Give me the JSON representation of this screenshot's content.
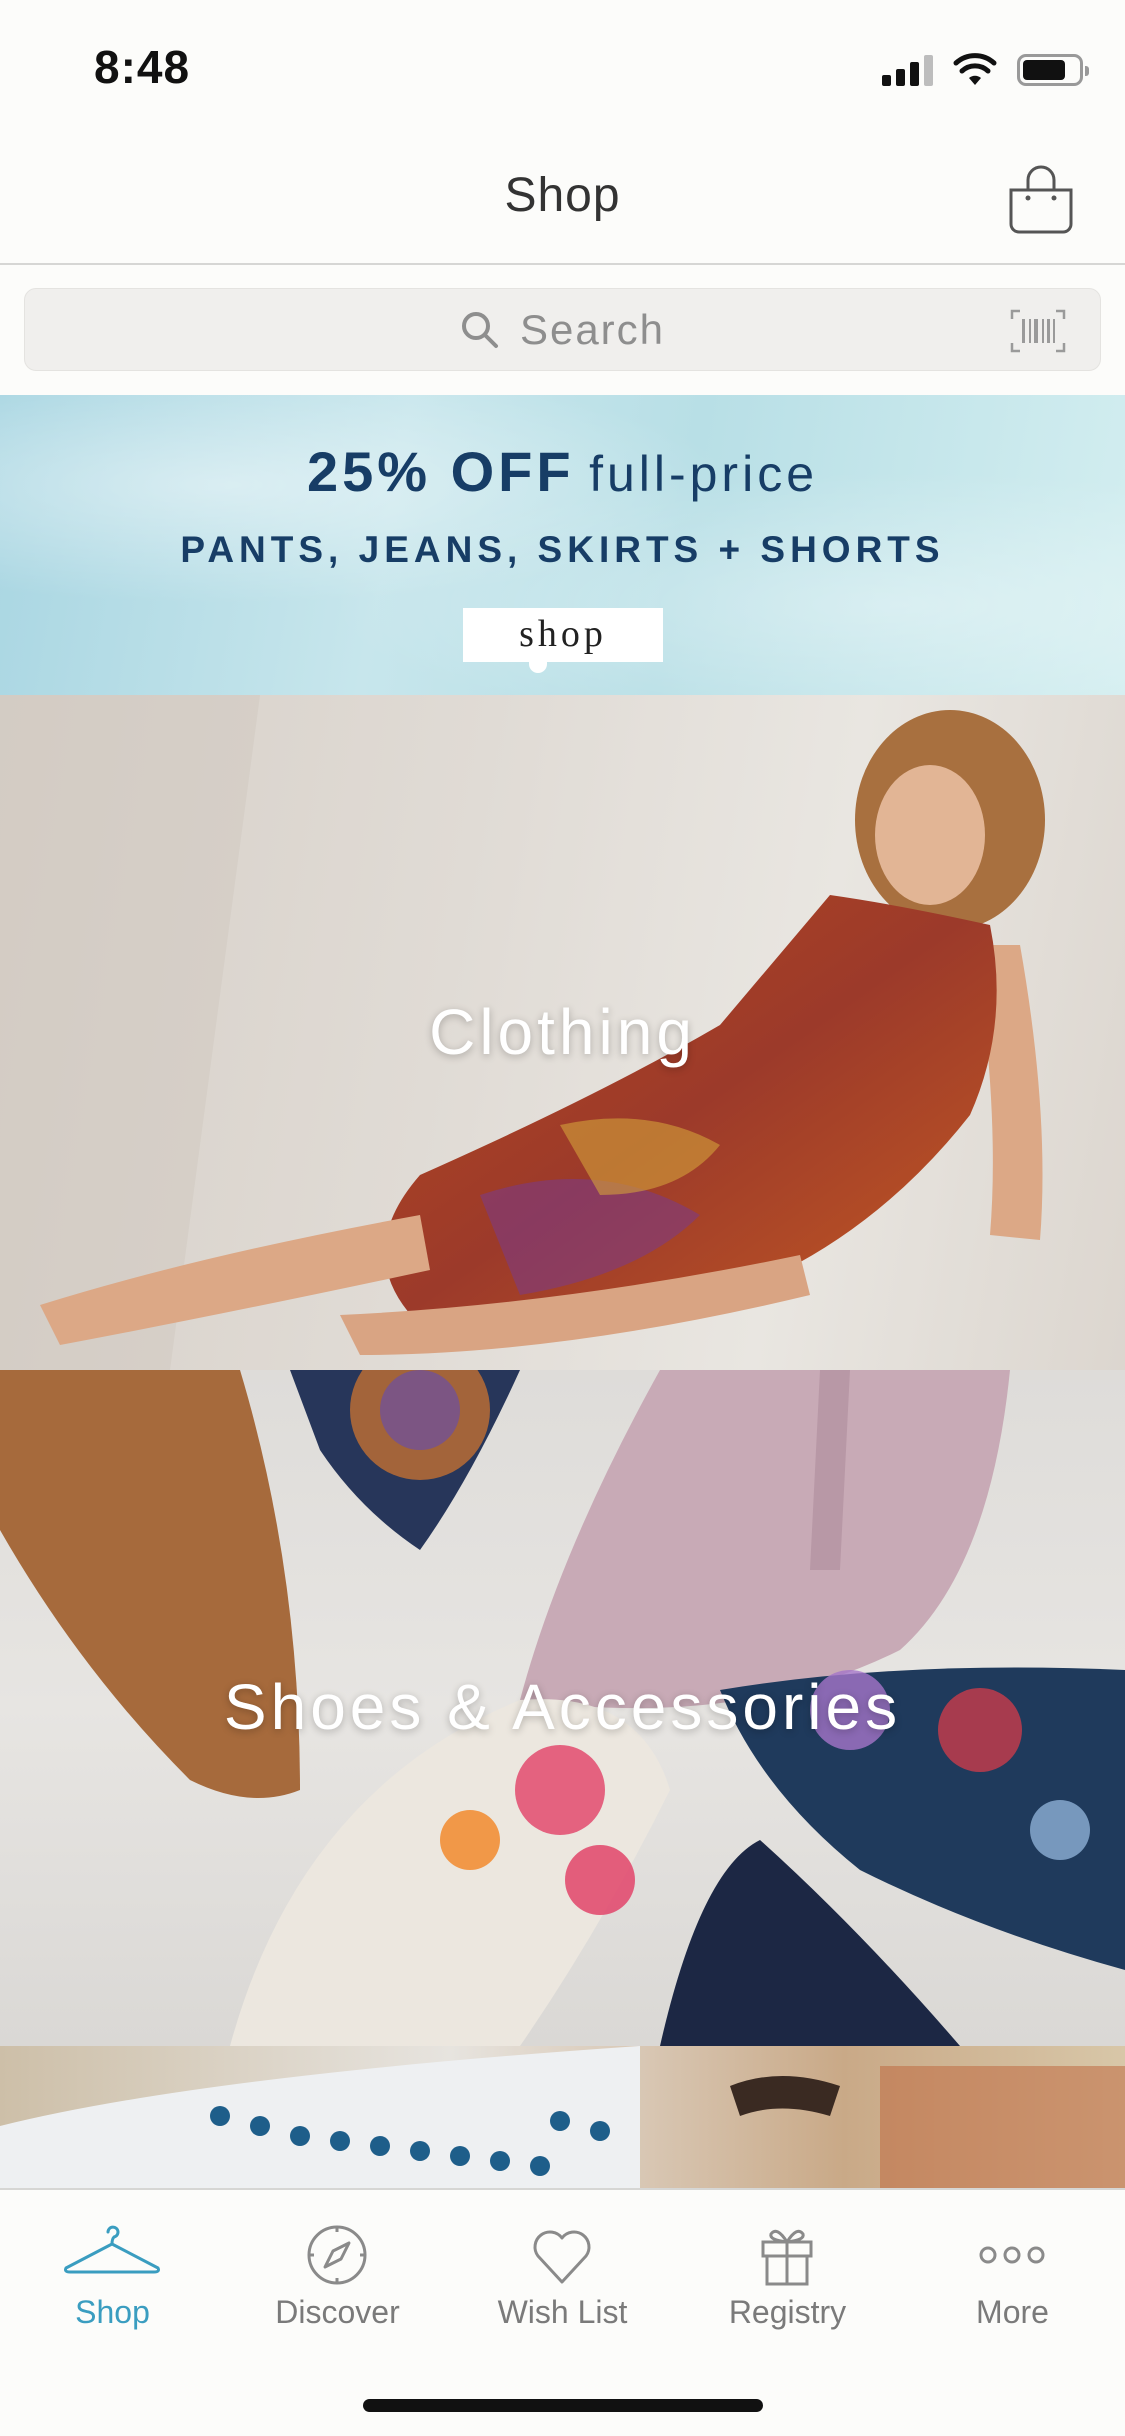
{
  "status_bar": {
    "time": "8:48"
  },
  "header": {
    "title": "Shop"
  },
  "search": {
    "placeholder": "Search"
  },
  "promo": {
    "percent": "25% OFF",
    "qualifier": "full-price",
    "categories": "PANTS, JEANS, SKIRTS + SHORTS",
    "cta": "shop"
  },
  "tiles": [
    {
      "label": "Clothing"
    },
    {
      "label": "Shoes & Accessories"
    },
    {
      "label": ""
    }
  ],
  "tabs": [
    {
      "label": "Shop",
      "icon": "hanger-icon",
      "active": true
    },
    {
      "label": "Discover",
      "icon": "compass-icon",
      "active": false
    },
    {
      "label": "Wish List",
      "icon": "heart-icon",
      "active": false
    },
    {
      "label": "Registry",
      "icon": "gift-icon",
      "active": false
    },
    {
      "label": "More",
      "icon": "more-dots-icon",
      "active": false
    }
  ],
  "colors": {
    "accent": "#3a9dc0",
    "promo_text": "#173d66"
  }
}
